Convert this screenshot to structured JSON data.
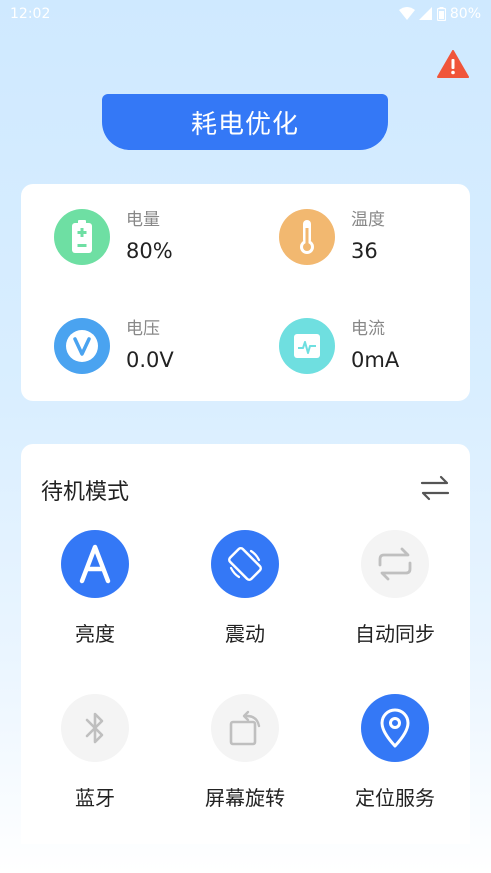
{
  "status_bar": {
    "time": "12:02",
    "battery": "80%"
  },
  "optimize_button": {
    "label": "耗电优化"
  },
  "info": [
    {
      "label": "电量",
      "value": "80%",
      "icon": "battery-icon",
      "color": "#6edfa3"
    },
    {
      "label": "温度",
      "value": "36",
      "icon": "thermometer-icon",
      "color": "#f2b870"
    },
    {
      "label": "电压",
      "value": "0.0V",
      "icon": "voltage-icon",
      "color": "#4aa3f0"
    },
    {
      "label": "电流",
      "value": "0mA",
      "icon": "current-icon",
      "color": "#6fdfe0"
    }
  ],
  "mode": {
    "title": "待机模式",
    "items": [
      {
        "label": "亮度",
        "icon": "brightness-icon",
        "active": true
      },
      {
        "label": "震动",
        "icon": "vibrate-icon",
        "active": true
      },
      {
        "label": "自动同步",
        "icon": "sync-icon",
        "active": false
      },
      {
        "label": "蓝牙",
        "icon": "bluetooth-icon",
        "active": false
      },
      {
        "label": "屏幕旋转",
        "icon": "rotate-icon",
        "active": false
      },
      {
        "label": "定位服务",
        "icon": "location-icon",
        "active": true
      }
    ]
  },
  "colors": {
    "accent": "#3478f6",
    "warning": "#f0553a"
  }
}
